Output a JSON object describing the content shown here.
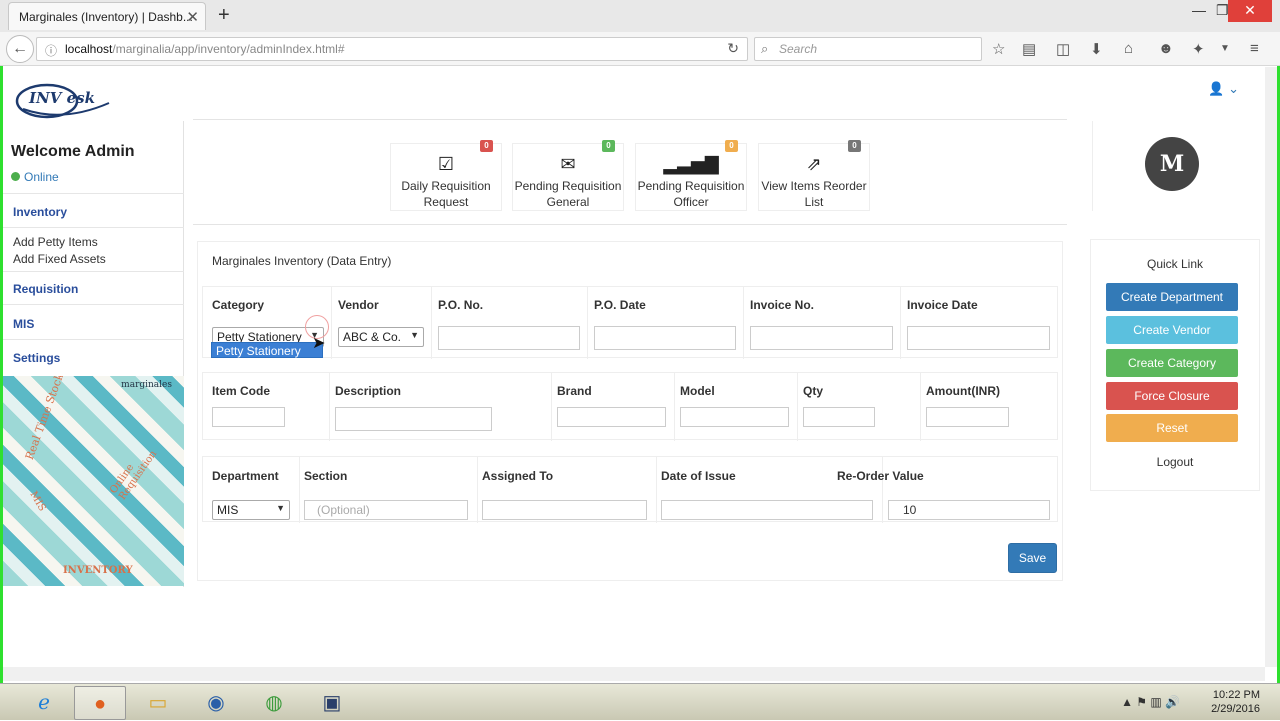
{
  "browser": {
    "tab_title": "Marginales (Inventory) | Dashb...",
    "tab_close": "✕",
    "new_tab": "+",
    "url_host": "localhost",
    "url_path": "/marginalia/app/inventory/adminIndex.html#",
    "search_placeholder": "Search"
  },
  "header": {
    "logo_text": "INV esk"
  },
  "sidebar": {
    "welcome": "Welcome Admin",
    "status": "Online",
    "inventory": "Inventory",
    "add_petty": "Add Petty Items",
    "add_fixed": "Add Fixed Assets",
    "requisition": "Requisition",
    "mis": "MIS",
    "settings": "Settings",
    "promo": {
      "brand": "marginales",
      "line1": "Real Time Stock",
      "line2": "Online Requisition",
      "line3": "MIS",
      "footer": "INVENTORY"
    }
  },
  "stats": [
    {
      "label1": "Daily Requisition",
      "label2": "Request",
      "count": "0",
      "color": "#d9534f",
      "icon": "check-square-icon"
    },
    {
      "label1": "Pending Requisition",
      "label2": "General",
      "count": "0",
      "color": "#5cb85c",
      "icon": "envelope-icon"
    },
    {
      "label1": "Pending Requisition",
      "label2": "Officer",
      "count": "0",
      "color": "#f0ad4e",
      "icon": "signal-bars-icon"
    },
    {
      "label1": "View Items Reorder",
      "label2": "List",
      "count": "0",
      "color": "#777777",
      "icon": "external-link-icon"
    }
  ],
  "form": {
    "title": "Marginales Inventory (Data Entry)",
    "row1": {
      "category": "Category",
      "vendor": "Vendor",
      "po_no": "P.O. No.",
      "po_date": "P.O. Date",
      "invoice_no": "Invoice No.",
      "invoice_date": "Invoice Date",
      "category_value": "Petty Stationery",
      "category_option_highlighted": "Petty Stationery",
      "vendor_value": "ABC & Co."
    },
    "row2": {
      "item_code": "Item Code",
      "description": "Description",
      "brand": "Brand",
      "model": "Model",
      "qty": "Qty",
      "amount": "Amount(INR)"
    },
    "row3": {
      "department": "Department",
      "section": "Section",
      "assigned_to": "Assigned To",
      "date_of_issue": "Date of Issue",
      "reorder_value": "Re-Order Value",
      "department_value": "MIS",
      "section_placeholder": "(Optional)",
      "reorder_value_input": "10"
    },
    "save": "Save"
  },
  "right_panel": {
    "avatar": "M",
    "quick_link": "Quick Link",
    "buttons": [
      {
        "label": "Create Department",
        "color": "#337ab7"
      },
      {
        "label": "Create Vendor",
        "color": "#5bc0de"
      },
      {
        "label": "Create Category",
        "color": "#5cb85c"
      },
      {
        "label": "Force Closure",
        "color": "#d9534f"
      },
      {
        "label": "Reset",
        "color": "#f0ad4e"
      }
    ],
    "logout": "Logout"
  },
  "taskbar": {
    "time": "10:22 PM",
    "date": "2/29/2016"
  }
}
